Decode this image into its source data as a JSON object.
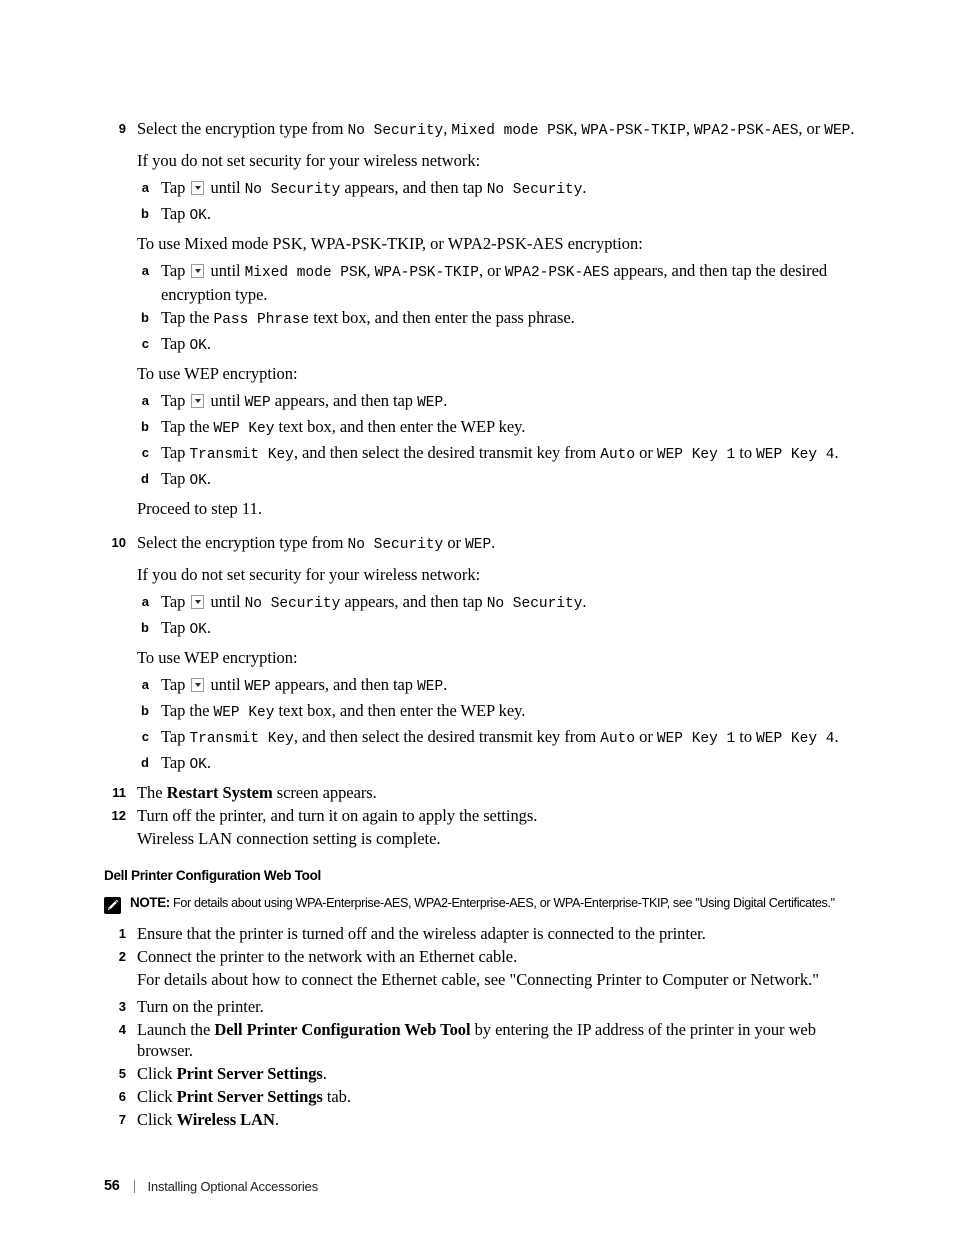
{
  "page": {
    "footer_page_number": "56",
    "footer_title": "Installing Optional Accessories"
  },
  "steps": {
    "s9": {
      "number": "9",
      "text_a": "Select the encryption type from ",
      "opt1": "No Security",
      "sep1": ", ",
      "opt2": "Mixed mode PSK",
      "sep2": ", ",
      "opt3": "WPA-PSK-TKIP",
      "sep3": ", ",
      "opt4": "WPA2-PSK-AES",
      "sep4": ", or ",
      "opt5": "WEP",
      "end": ".",
      "intro_nosec": "If you do not set security for your wireless network:",
      "a_pre": "Tap ",
      "a_mid": " until ",
      "a_target": "No Security",
      "a_post": " appears, and then tap ",
      "a_target2": "No Security",
      "a_end": ".",
      "b_pre": "Tap ",
      "b_ok": "OK",
      "b_end": ".",
      "intro_mixed": "To use Mixed mode PSK, WPA-PSK-TKIP, or WPA2-PSK-AES encryption:",
      "m_a_pre": "Tap ",
      "m_a_mid": " until ",
      "m_a_o1": "Mixed mode PSK",
      "m_a_s1": ", ",
      "m_a_o2": "WPA-PSK-TKIP",
      "m_a_s2": ", or ",
      "m_a_o3": "WPA2-PSK-AES",
      "m_a_post": " appears, and then tap the desired encryption type.",
      "m_b_pre": "Tap the ",
      "m_b_field": "Pass Phrase",
      "m_b_post": " text box, and then enter the pass phrase.",
      "m_c_pre": "Tap ",
      "m_c_ok": "OK",
      "m_c_end": ".",
      "intro_wep": "To use WEP encryption:",
      "w_a_pre": "Tap ",
      "w_a_mid": " until ",
      "w_a_t1": "WEP",
      "w_a_post": " appears, and then tap ",
      "w_a_t2": "WEP",
      "w_a_end": ".",
      "w_b_pre": "Tap the ",
      "w_b_field": "WEP Key",
      "w_b_post": " text box, and then enter the WEP key.",
      "w_c_pre": "Tap ",
      "w_c_field": "Transmit Key",
      "w_c_mid": ", and then select the desired transmit key from ",
      "w_c_auto": "Auto",
      "w_c_or": " or ",
      "w_c_k1": "WEP Key 1",
      "w_c_to": " to ",
      "w_c_k4": "WEP Key 4",
      "w_c_end": ".",
      "w_d_pre": "Tap ",
      "w_d_ok": "OK",
      "w_d_end": ".",
      "proceed": "Proceed to step 11."
    },
    "s10": {
      "number": "10",
      "text_a": "Select the encryption type from ",
      "opt1": "No Security",
      "sep1": " or ",
      "opt2": "WEP",
      "end": ".",
      "intro_nosec": "If you do not set security for your wireless network:",
      "a_pre": "Tap ",
      "a_mid": " until ",
      "a_target": "No Security",
      "a_post": " appears, and then tap ",
      "a_target2": "No Security",
      "a_end": ".",
      "b_pre": "Tap ",
      "b_ok": "OK",
      "b_end": ".",
      "intro_wep": "To use WEP encryption:",
      "w_a_pre": "Tap ",
      "w_a_mid": " until ",
      "w_a_t1": "WEP",
      "w_a_post": " appears, and then tap ",
      "w_a_t2": "WEP",
      "w_a_end": ".",
      "w_b_pre": "Tap the ",
      "w_b_field": "WEP Key",
      "w_b_post": " text box, and then enter the WEP key.",
      "w_c_pre": "Tap ",
      "w_c_field": "Transmit Key",
      "w_c_mid": ", and then select the desired transmit key from ",
      "w_c_auto": "Auto",
      "w_c_or": " or ",
      "w_c_k1": "WEP Key 1",
      "w_c_to": " to ",
      "w_c_k4": "WEP Key 4",
      "w_c_end": ".",
      "w_d_pre": "Tap ",
      "w_d_ok": "OK",
      "w_d_end": "."
    },
    "s11": {
      "number": "11",
      "pre": "The ",
      "bold": "Restart System",
      "post": " screen appears."
    },
    "s12": {
      "number": "12",
      "text": "Turn off the printer, and turn it on again to apply the settings.",
      "sub": "Wireless LAN connection setting is complete."
    }
  },
  "letters": {
    "a": "a",
    "b": "b",
    "c": "c",
    "d": "d"
  },
  "section": {
    "heading": "Dell Printer Configuration Web Tool",
    "note_label": "NOTE:",
    "note_text": " For details about using WPA-Enterprise-AES, WPA2-Enterprise-AES, or WPA-Enterprise-TKIP, see \"Using Digital Certificates.\"",
    "steps": {
      "n1": "1",
      "t1": "Ensure that the printer is turned off and the wireless adapter is connected to the printer.",
      "n2": "2",
      "t2": "Connect the printer to the network with an Ethernet cable.",
      "t2sub": "For details about how to connect the Ethernet cable, see \"Connecting Printer to Computer or Network.\"",
      "n3": "3",
      "t3": "Turn on the printer.",
      "n4": "4",
      "t4_pre": "Launch the ",
      "t4_bold": "Dell Printer Configuration Web Tool",
      "t4_post": " by entering the IP address of the printer in your web browser.",
      "n5": "5",
      "t5_pre": "Click ",
      "t5_bold": "Print Server Settings",
      "t5_post": ".",
      "n6": "6",
      "t6_pre": "Click ",
      "t6_bold": "Print Server Settings",
      "t6_post": " tab.",
      "n7": "7",
      "t7_pre": "Click ",
      "t7_bold": "Wireless LAN",
      "t7_post": "."
    }
  }
}
